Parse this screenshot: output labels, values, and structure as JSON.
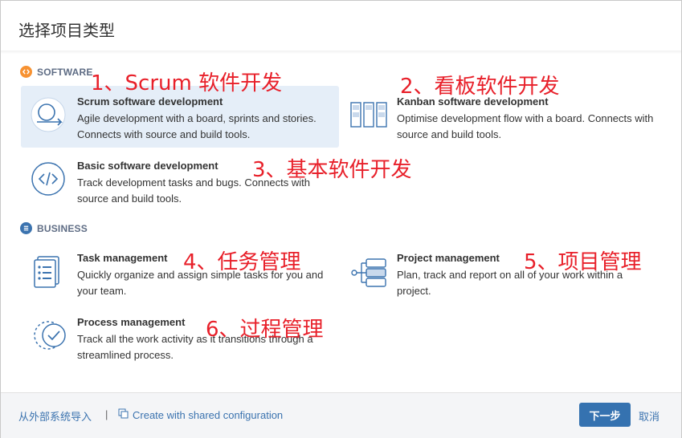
{
  "dialog": {
    "title": "选择项目类型"
  },
  "sections": {
    "software": {
      "label": "SOFTWARE",
      "icon": "code-icon",
      "color": "#f79232"
    },
    "business": {
      "label": "BUSINESS",
      "icon": "list-icon",
      "color": "#3b73af"
    }
  },
  "items": {
    "scrum": {
      "name": "Scrum software development",
      "desc": "Agile development with a board, sprints and stories. Connects with source and build tools.",
      "annotation": "1、Scrum 软件开发"
    },
    "kanban": {
      "name": "Kanban software development",
      "desc": "Optimise development flow with a board. Connects with source and build tools.",
      "annotation": "2、看板软件开发"
    },
    "basic": {
      "name": "Basic software development",
      "desc": "Track development tasks and bugs. Connects with source and build tools.",
      "annotation": "3、基本软件开发"
    },
    "task": {
      "name": "Task management",
      "desc": "Quickly organize and assign simple tasks for you and your team.",
      "annotation": "4、任务管理"
    },
    "project": {
      "name": "Project management",
      "desc": "Plan, track and report on all of your work within a project.",
      "annotation": "5、项目管理"
    },
    "process": {
      "name": "Process management",
      "desc": "Track all the work activity as it transitions through a streamlined process.",
      "annotation": "6、过程管理"
    }
  },
  "footer": {
    "import_label": "从外部系统导入",
    "separator": "|",
    "shared_config_label": "Create with shared configuration",
    "next_label": "下一步",
    "cancel_label": "取消"
  },
  "colors": {
    "accent": "#3572b0",
    "link": "#3b73af",
    "selected_bg": "#e5eef8",
    "annotation": "#e8202a"
  }
}
